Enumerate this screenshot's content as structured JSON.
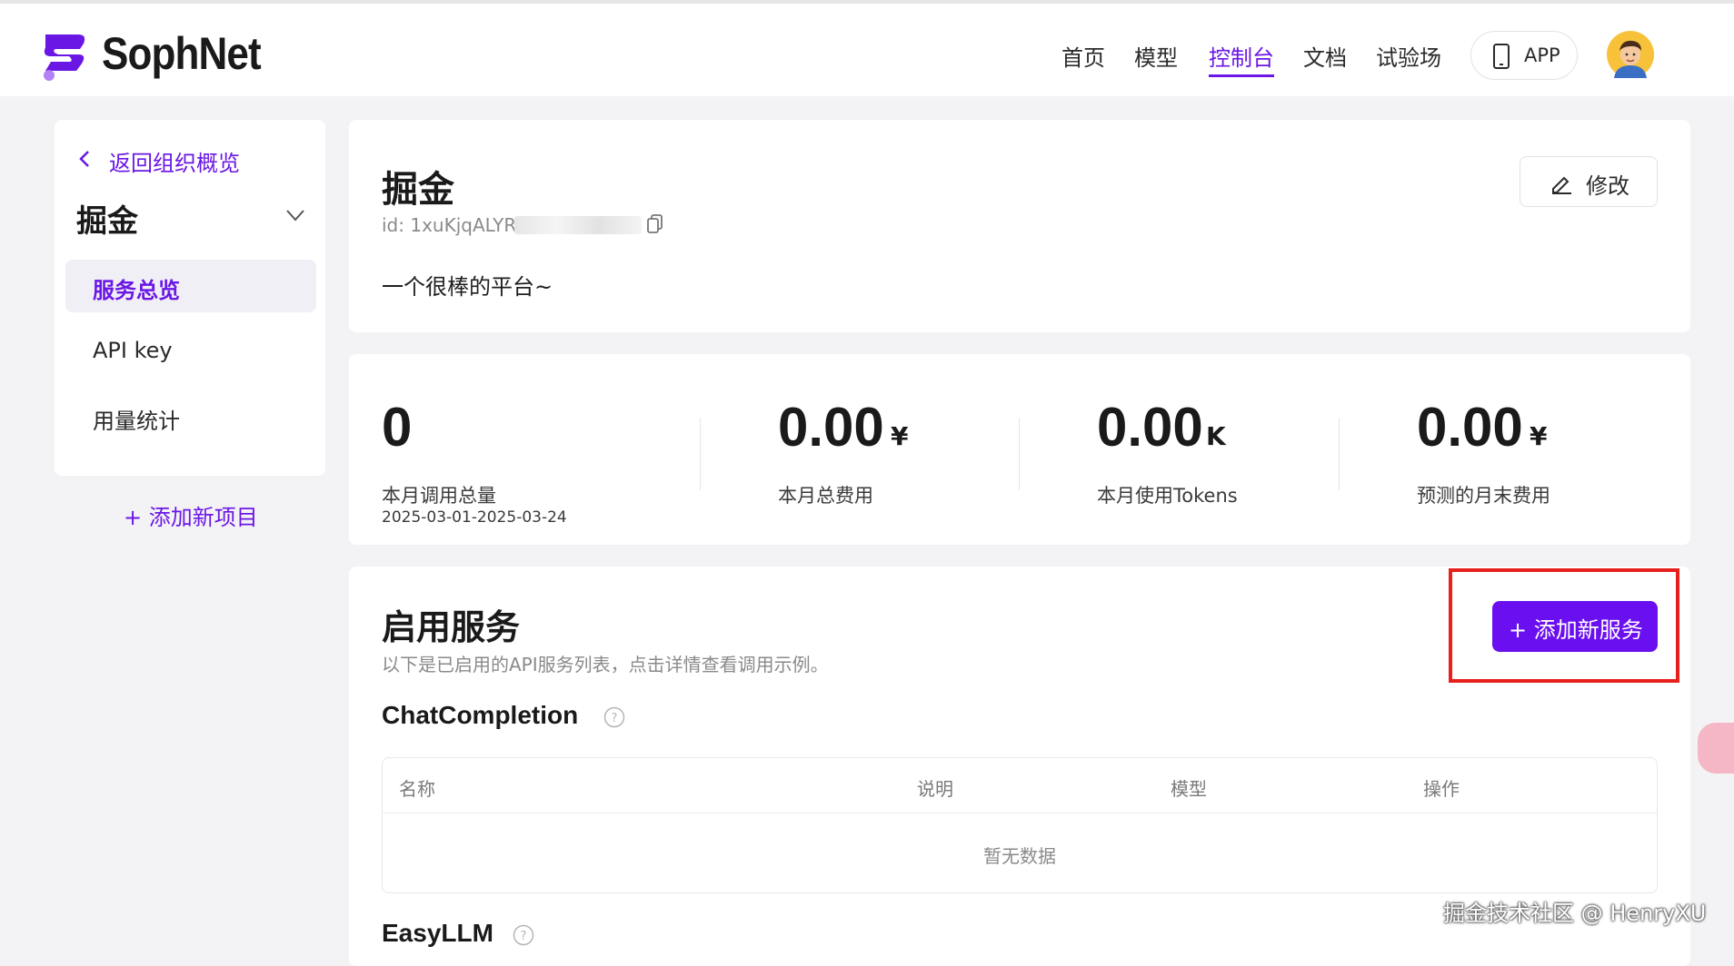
{
  "header": {
    "brand": "SophNet",
    "nav": [
      "首页",
      "模型",
      "控制台",
      "文档",
      "试验场"
    ],
    "active_nav": "控制台",
    "app_label": "APP"
  },
  "sidebar": {
    "back_label": "返回组织概览",
    "org_name": "掘金",
    "items": [
      "服务总览",
      "API key",
      "用量统计"
    ],
    "active_item": "服务总览",
    "add_project": "+  添加新项目"
  },
  "project": {
    "name": "掘金",
    "id_prefix": "id: 1xuKjqALYR",
    "description": "一个很棒的平台~",
    "edit_label": "修改"
  },
  "stats": [
    {
      "value": "0",
      "unit": "",
      "label": "本月调用总量",
      "sub": "2025-03-01-2025-03-24"
    },
    {
      "value": "0.00",
      "unit": "¥",
      "label": "本月总费用",
      "sub": ""
    },
    {
      "value": "0.00",
      "unit": "K",
      "label": "本月使用Tokens",
      "sub": ""
    },
    {
      "value": "0.00",
      "unit": "¥",
      "label": "预测的月末费用",
      "sub": ""
    }
  ],
  "services": {
    "title": "启用服务",
    "subtitle": "以下是已启用的API服务列表，点击详情查看调用示例。",
    "add_label": "+  添加新服务",
    "sections": [
      {
        "name": "ChatCompletion",
        "columns": [
          "名称",
          "说明",
          "模型",
          "操作"
        ],
        "empty_text": "暂无数据"
      },
      {
        "name": "EasyLLM"
      }
    ]
  },
  "footer_watermark": "掘金技术社区 @ HenryXU",
  "colors": {
    "accent": "#6a17e6",
    "button": "#6a0ff0",
    "highlight": "#e8201b",
    "background": "#f3f3f5"
  },
  "icons": [
    "logo-icon",
    "phone-icon",
    "avatar",
    "chevron-left-icon",
    "chevron-down-icon",
    "copy-icon",
    "edit-icon",
    "help-icon"
  ]
}
